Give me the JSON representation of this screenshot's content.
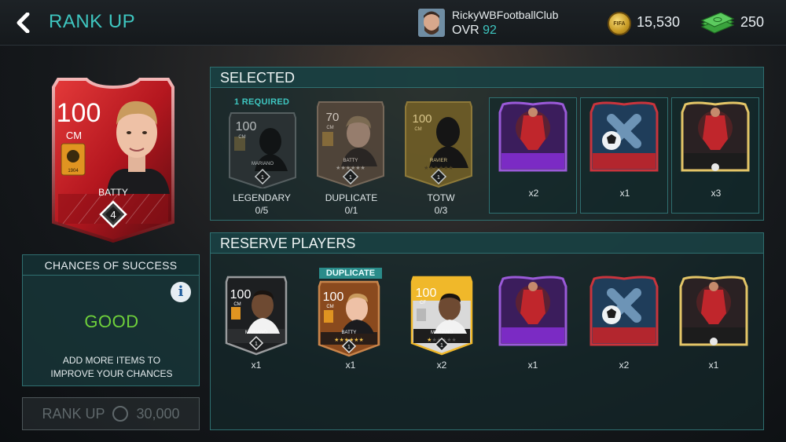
{
  "header": {
    "title": "RANK UP",
    "username": "RickyWBFootballClub",
    "ovr_label": "OVR",
    "ovr_value": "92",
    "coins": "15,530",
    "cash": "250",
    "coin_icon_text": "FIFA"
  },
  "player_card": {
    "rating": "100",
    "position": "CM",
    "name": "BATTY",
    "rank": "4",
    "badge_year": "1904",
    "colors": {
      "primary": "#b5171f",
      "dark": "#5a0b10",
      "highlight": "#e43a3a"
    }
  },
  "chances": {
    "heading": "CHANCES OF SUCCESS",
    "result": "GOOD",
    "hint_line1": "ADD MORE ITEMS TO",
    "hint_line2": "IMPROVE YOUR CHANCES",
    "result_color": "#6fd13b"
  },
  "rank_button": {
    "label": "RANK UP",
    "cost": "30,000"
  },
  "selected": {
    "heading": "SELECTED",
    "requirement": "1 REQUIRED",
    "slots": [
      {
        "kind": "legendary",
        "card_rating": "100",
        "card_pos": "CM",
        "card_name": "MARIANO",
        "label": "LEGENDARY",
        "count": "0/5",
        "rank": "1"
      },
      {
        "kind": "duplicate",
        "card_rating": "70",
        "card_pos": "CM",
        "card_name": "BATTY",
        "label": "DUPLICATE",
        "count": "0/1",
        "rank": "1"
      },
      {
        "kind": "totw",
        "card_rating": "100",
        "card_pos": "CM",
        "card_name": "RAVIER",
        "label": "TOTW",
        "count": "0/3",
        "rank": "1"
      }
    ],
    "items": [
      {
        "kind": "purple-player-item",
        "qty": "x2"
      },
      {
        "kind": "red-ball-item",
        "qty": "x1"
      },
      {
        "kind": "gold-player-item",
        "qty": "x3"
      }
    ]
  },
  "reserve": {
    "heading": "RESERVE PLAYERS",
    "duplicate_tag": "DUPLICATE",
    "players": [
      {
        "kind": "black",
        "rating": "100",
        "pos": "CM",
        "name": "MARIANO",
        "qty": "x1",
        "rank": "1"
      },
      {
        "kind": "bronze",
        "rating": "100",
        "pos": "CM",
        "name": "BATTY",
        "qty": "x1",
        "rank": "1"
      },
      {
        "kind": "gold",
        "rating": "100",
        "pos": "CF",
        "name": "MARIANO",
        "qty": "x2",
        "rank": "1"
      }
    ],
    "items": [
      {
        "kind": "purple-player-item",
        "qty": "x1"
      },
      {
        "kind": "red-ball-item",
        "qty": "x2"
      },
      {
        "kind": "gold-player-item",
        "qty": "x1"
      }
    ]
  }
}
